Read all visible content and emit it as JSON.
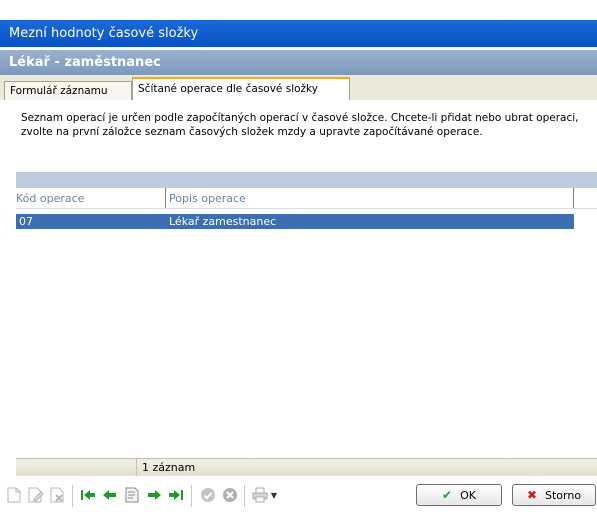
{
  "window": {
    "title": "Mezní hodnoty časové složky"
  },
  "header": {
    "title": "Lékař - zaměstnanec"
  },
  "tabs": [
    {
      "label": "Formulář záznamu",
      "active": false
    },
    {
      "label": "Sčítané operace dle časové složky",
      "active": true
    }
  ],
  "info_text": "Seznam operací je určen podle započítaných operací v časové složce. Chcete-li přidat nebo ubrat operaci, zvolte na první záložce seznam časových složek mzdy a upravte započítávané operace.",
  "grid": {
    "columns": [
      "Kód operace",
      "Popis operace"
    ],
    "rows": [
      {
        "code": "07",
        "description": "Lékař zamestnanec"
      }
    ]
  },
  "status": {
    "count": "1 záznam"
  },
  "buttons": {
    "ok": "OK",
    "storno": "Storno"
  },
  "colors": {
    "title_bar": "#0a52c4",
    "selection": "#3d6eb2",
    "tab_accent": "#f5a623"
  },
  "toolbar_icons": [
    "new-icon",
    "edit-icon",
    "delete-icon",
    "first-record-icon",
    "previous-record-icon",
    "record-detail-icon",
    "next-record-icon",
    "last-record-icon",
    "confirm-icon",
    "cancel-icon",
    "print-icon",
    "print-dropdown-icon"
  ]
}
